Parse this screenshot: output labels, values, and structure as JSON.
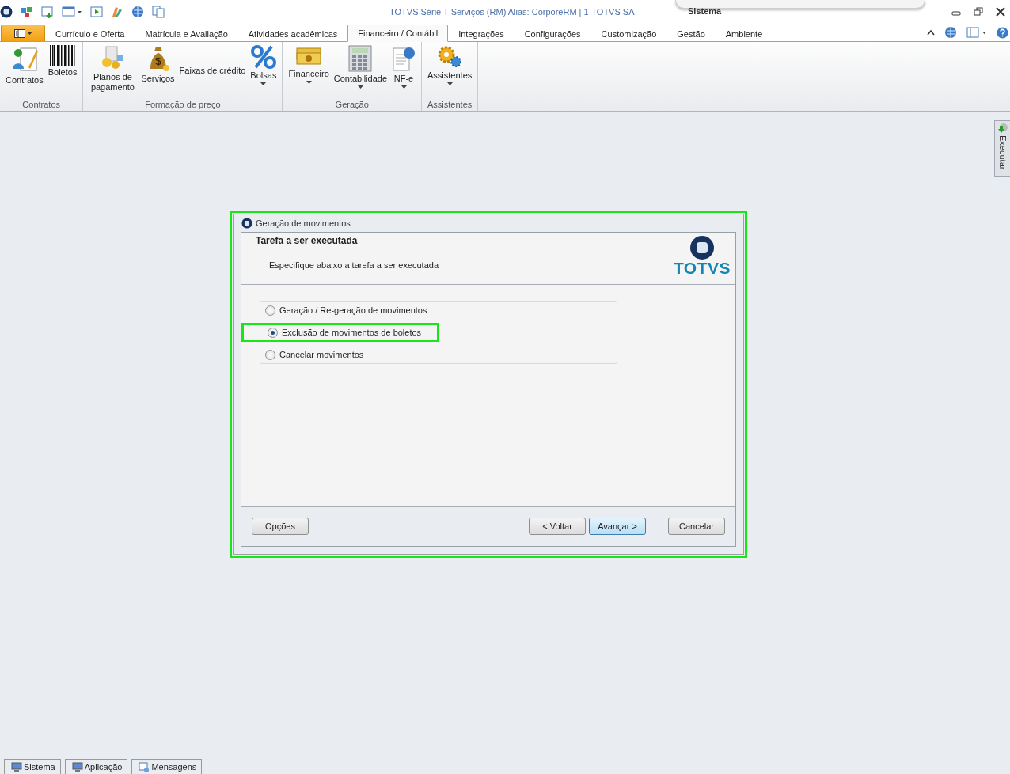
{
  "window": {
    "title": "TOTVS Série T Serviços (RM) Alias: CorporeRM | 1-TOTVS SA",
    "context_tab": "Sistema"
  },
  "menu_tabs": [
    {
      "label": "Currículo e Oferta",
      "selected": false
    },
    {
      "label": "Matrícula e Avaliação",
      "selected": false
    },
    {
      "label": "Atividades acadêmicas",
      "selected": false
    },
    {
      "label": "Financeiro / Contábil",
      "selected": true
    },
    {
      "label": "Integrações",
      "selected": false
    },
    {
      "label": "Configurações",
      "selected": false
    },
    {
      "label": "Customização",
      "selected": false
    },
    {
      "label": "Gestão",
      "selected": false
    },
    {
      "label": "Ambiente",
      "selected": false
    }
  ],
  "ribbon_groups": [
    {
      "label": "Contratos",
      "items": [
        {
          "label": "Contratos",
          "kind": "contract",
          "dropdown": false
        },
        {
          "label": "Boletos",
          "kind": "barcode",
          "dropdown": false
        }
      ]
    },
    {
      "label": "Formação de preço",
      "items": [
        {
          "label": "Planos de pagamento",
          "kind": "coins",
          "dropdown": false
        },
        {
          "label": "Serviços",
          "kind": "moneybag",
          "dropdown": false
        },
        {
          "label": "Faixas de crédito",
          "kind": "text",
          "dropdown": false
        },
        {
          "label": "Bolsas",
          "kind": "percent",
          "dropdown": true
        }
      ]
    },
    {
      "label": "Geração",
      "items": [
        {
          "label": "Financeiro",
          "kind": "banknote",
          "dropdown": true
        },
        {
          "label": "Contabilidade",
          "kind": "calculator",
          "dropdown": true
        },
        {
          "label": "NF-e",
          "kind": "document",
          "dropdown": true
        }
      ]
    },
    {
      "label": "Assistentes",
      "items": [
        {
          "label": "Assistentes",
          "kind": "gears",
          "dropdown": true
        }
      ]
    }
  ],
  "side_panel": {
    "label": "Executar"
  },
  "dialog": {
    "title": "Geração de movimentos",
    "highlighted": true,
    "heading": "Tarefa a ser executada",
    "description": "Especifique abaixo a tarefa a ser executada",
    "logo": "TOTVS",
    "options": [
      {
        "label": "Geração / Re-geração de movimentos",
        "selected": false,
        "highlighted": false
      },
      {
        "label": "Exclusão de movimentos de boletos",
        "selected": true,
        "highlighted": true
      },
      {
        "label": "Cancelar movimentos",
        "selected": false,
        "highlighted": false
      }
    ],
    "buttons": [
      {
        "label": "Opções",
        "kind": "aside",
        "default": false
      },
      {
        "label": "< Voltar",
        "kind": "nav",
        "default": false
      },
      {
        "label": "Avançar >",
        "kind": "nav",
        "default": true
      },
      {
        "label": "Cancelar",
        "kind": "cancel",
        "default": false
      }
    ]
  },
  "taskbar": [
    {
      "label": "Sistema",
      "kind": "monitor"
    },
    {
      "label": "Aplicação",
      "kind": "monitor"
    },
    {
      "label": "Mensagens",
      "kind": "messages"
    }
  ]
}
